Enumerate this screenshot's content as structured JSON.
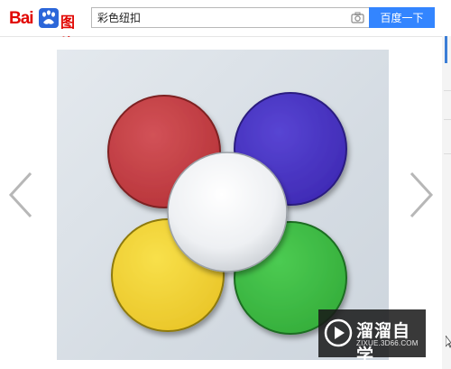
{
  "header": {
    "logo_latin": "Bai",
    "logo_image_text": "图片",
    "search": {
      "value": "彩色纽扣",
      "placeholder": ""
    },
    "search_button_label": "百度一下"
  },
  "viewer": {
    "image": {
      "subject": "colored buttons",
      "colors": {
        "red": "#c73b40",
        "purple": "#4a35c8",
        "white": "#f2f3f5",
        "yellow": "#f2d633",
        "green": "#3fbd45"
      }
    },
    "prev_icon": "chevron-left-icon",
    "next_icon": "chevron-right-icon"
  },
  "watermark": {
    "title": "溜溜自学",
    "url": "ZIXUE.3D66.COM"
  }
}
